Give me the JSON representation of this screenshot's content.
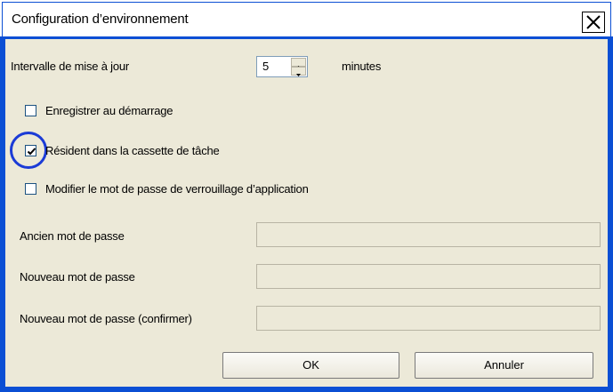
{
  "window": {
    "title": "Configuration d’environnement",
    "close_glyph": "✕"
  },
  "update_interval": {
    "label": "Intervalle de mise à jour",
    "value": "5",
    "unit": "minutes"
  },
  "options": [
    {
      "label": "Enregistrer au démarrage",
      "checked": false
    },
    {
      "label": "Résident dans la cassette de tâche",
      "checked": true
    },
    {
      "label": "Modifier le mot de passe de verrouillage d’application",
      "checked": false
    }
  ],
  "password_fields": [
    {
      "label": "Ancien mot de passe",
      "value": ""
    },
    {
      "label": "Nouveau mot de passe",
      "value": ""
    },
    {
      "label": "Nouveau mot de passe (confirmer)",
      "value": ""
    }
  ],
  "buttons": {
    "ok": "OK",
    "cancel": "Annuler"
  },
  "colors": {
    "titlebar_border": "#0b4fd4",
    "dialog_background": "#ece9d8",
    "highlight_circle": "#1b3bd6"
  }
}
